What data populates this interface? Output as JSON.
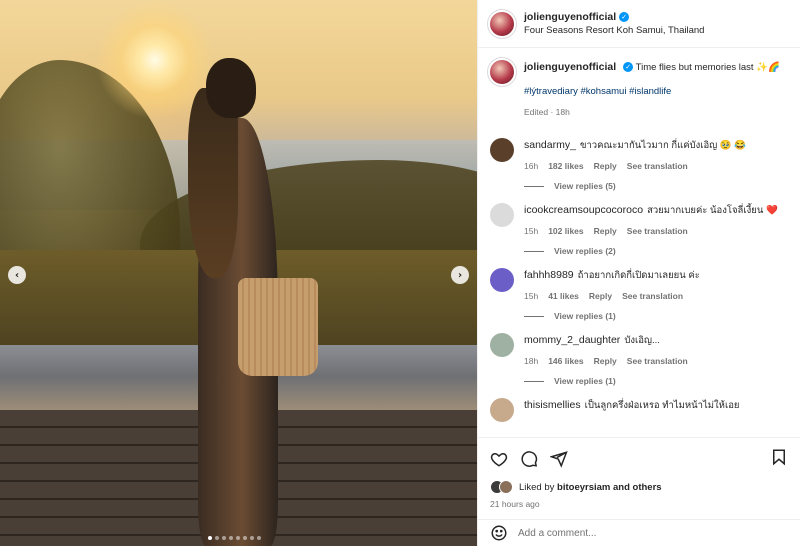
{
  "post": {
    "username": "jolienguyenofficial",
    "location": "Four Seasons Resort Koh Samui, Thailand",
    "caption_text": "Time flies but memories last ✨🌈",
    "hashtags": "#lýtravediary #kohsamui #islandlife",
    "caption_meta": "Edited · 18h"
  },
  "carousel": {
    "total_slides": 8,
    "active_index": 0
  },
  "comments": [
    {
      "username": "sandarmy_",
      "text": "ขาวคณะมากันไวมาก กี่แค่บังเอิญ 🥹 😂",
      "time": "16h",
      "likes": "182 likes",
      "reply": "Reply",
      "translate": "See translation",
      "view_replies": "View replies (5)",
      "avatar_color": "#5a3f2a"
    },
    {
      "username": "icookcreamsoupcocoroco",
      "text": "สวยมากเบยค่ะ น้องโจลี่เงี้ยน ❤️",
      "time": "15h",
      "likes": "102 likes",
      "reply": "Reply",
      "translate": "See translation",
      "view_replies": "View replies (2)",
      "avatar_color": "#dbdbdb"
    },
    {
      "username": "fahhh8989",
      "text": "ถ้าอยากเกิดกี่เปิดมาเลยยน ค่ะ",
      "time": "15h",
      "likes": "41 likes",
      "reply": "Reply",
      "translate": "See translation",
      "view_replies": "View replies (1)",
      "avatar_color": "#6b5fc7"
    },
    {
      "username": "mommy_2_daughter",
      "text": "บังเอิญ...",
      "time": "18h",
      "likes": "146 likes",
      "reply": "Reply",
      "translate": "See translation",
      "view_replies": "View replies (1)",
      "avatar_color": "#9fb1a3"
    },
    {
      "username": "thisismellies",
      "text": "เป็นลูกครึ่งฝ่อเหรอ ทำไมหน้าไม่ให้เอย",
      "time": "",
      "likes": "",
      "reply": "",
      "translate": "",
      "view_replies": "",
      "avatar_color": "#c7a98c"
    }
  ],
  "actions": {
    "liked_by_prefix": "Liked by",
    "liked_by_user": "bitoeyrsiam",
    "liked_by_suffix": "and others",
    "timestamp": "21 hours ago"
  },
  "add_comment": {
    "placeholder": "Add a comment..."
  },
  "icons": {
    "heart": "heart-icon",
    "comment": "comment-icon",
    "share": "share-icon",
    "save": "bookmark-icon",
    "verified": "verified-badge-icon",
    "emoji": "emoji-icon",
    "arrow_left": "chevron-left-icon",
    "arrow_right": "chevron-right-icon"
  },
  "colors": {
    "link_blue": "#00376b",
    "verified_blue": "#0095f6",
    "muted": "#737373",
    "text": "#262626"
  }
}
